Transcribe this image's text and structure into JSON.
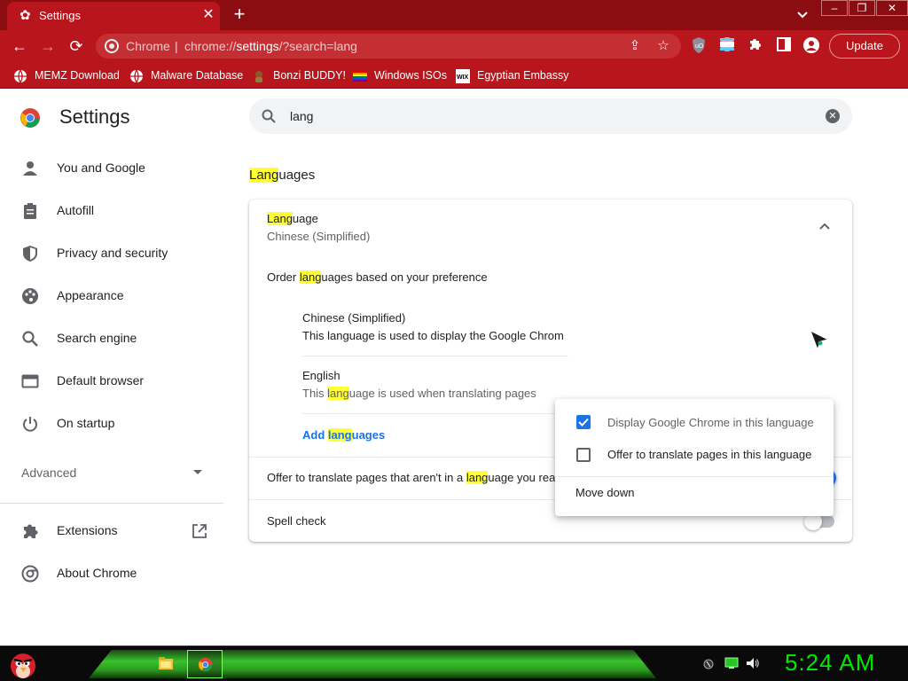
{
  "browser": {
    "tab": {
      "title": "Settings"
    },
    "omnibox": {
      "site": "Chrome",
      "url_prefix": "chrome://",
      "url_host": "settings",
      "url_rest": "/?search=lang"
    },
    "update_label": "Update",
    "bookmarks": [
      {
        "label": "MEMZ Download",
        "icon": "globe-icon"
      },
      {
        "label": "Malware Database",
        "icon": "globe-icon"
      },
      {
        "label": "Bonzi BUDDY!",
        "icon": "bonzi-icon"
      },
      {
        "label": "Windows ISOs",
        "icon": "rainbow-flag-icon"
      },
      {
        "label": "Egyptian Embassy",
        "icon": "wix-icon"
      }
    ],
    "colors": {
      "frame": "#8b0d12",
      "toolbar": "#b8151c"
    }
  },
  "settings": {
    "title": "Settings",
    "search": {
      "value": "lang"
    },
    "sidebar": {
      "items": [
        {
          "label": "You and Google",
          "icon": "person-icon"
        },
        {
          "label": "Autofill",
          "icon": "clipboard-icon"
        },
        {
          "label": "Privacy and security",
          "icon": "shield-icon"
        },
        {
          "label": "Appearance",
          "icon": "palette-icon"
        },
        {
          "label": "Search engine",
          "icon": "search-icon"
        },
        {
          "label": "Default browser",
          "icon": "browser-icon"
        },
        {
          "label": "On startup",
          "icon": "power-icon"
        }
      ],
      "advanced": "Advanced",
      "extensions": "Extensions",
      "about": "About Chrome"
    },
    "section": {
      "title_hl": "Lang",
      "title_rest": "uages"
    },
    "language": {
      "label_hl": "Lang",
      "label_rest": "uage",
      "current": "Chinese (Simplified)",
      "order_pre": "Order ",
      "order_hl": "lang",
      "order_post": "uages based on your preference",
      "entries": [
        {
          "name": "Chinese (Simplified)",
          "desc": "This language is used to display the Google Chrom"
        },
        {
          "name": "English",
          "desc_pre": "This ",
          "desc_hl": "lang",
          "desc_post": "uage is used when translating pages"
        }
      ],
      "add_pre": "Add ",
      "add_hl": "lang",
      "add_post": "uages"
    },
    "translate": {
      "pre": "Offer to translate pages that aren't in a ",
      "hl": "lang",
      "post": "uage you read",
      "enabled": true
    },
    "spellcheck": {
      "label": "Spell check",
      "enabled": false
    },
    "menu": {
      "display": {
        "label": "Display Google Chrome in this language",
        "checked": true
      },
      "offer": {
        "label": "Offer to translate pages in this language",
        "checked": false
      },
      "move_down": "Move down"
    },
    "accent": "#1a73e8"
  },
  "taskbar": {
    "time": "5:24 AM"
  }
}
